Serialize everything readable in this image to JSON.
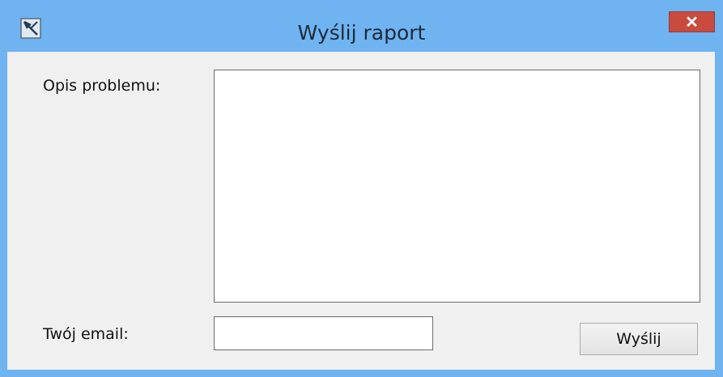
{
  "window": {
    "title": "Wyślij raport",
    "close_label": "✕",
    "app_icon": "close-x-app-icon"
  },
  "form": {
    "description_label": "Opis problemu:",
    "description_value": "",
    "email_label": "Twój email:",
    "email_value": "",
    "send_label": "Wyślij"
  },
  "colors": {
    "titlebar": "#6fb3f0",
    "close_button": "#c74b3f",
    "client_background": "#f0f0f0"
  }
}
